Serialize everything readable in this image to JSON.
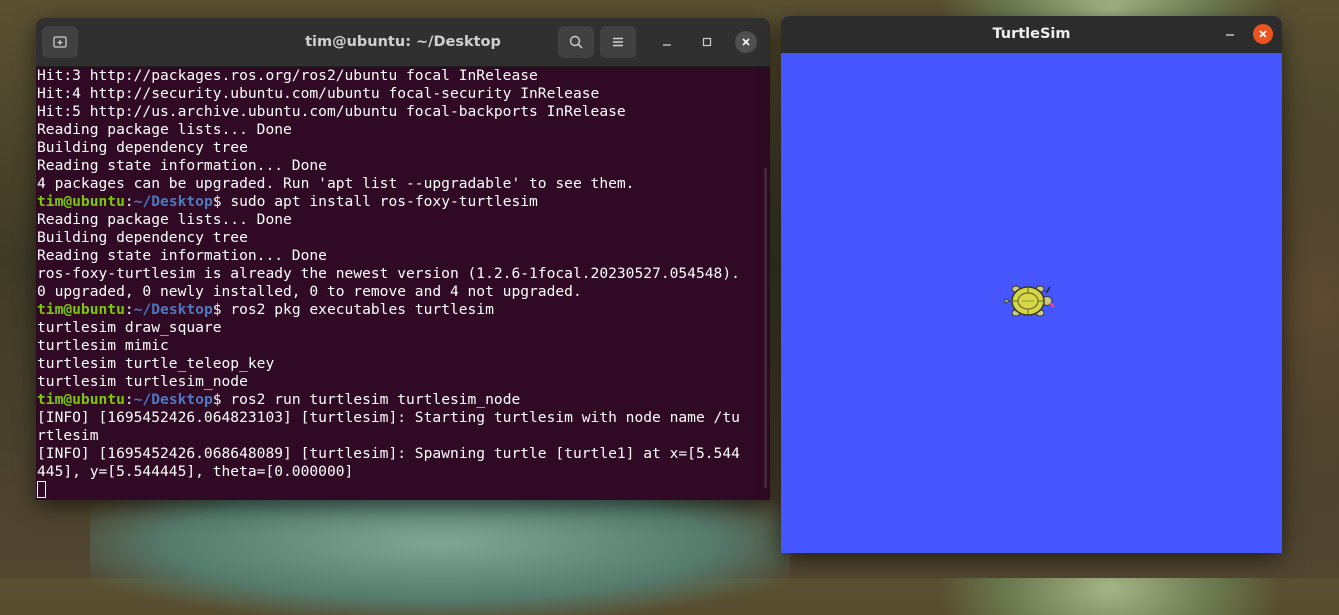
{
  "terminal": {
    "title": "tim@ubuntu: ~/Desktop",
    "lines": [
      {
        "type": "out",
        "text": "Hit:3 http://packages.ros.org/ros2/ubuntu focal InRelease"
      },
      {
        "type": "out",
        "text": "Hit:4 http://security.ubuntu.com/ubuntu focal-security InRelease"
      },
      {
        "type": "out",
        "text": "Hit:5 http://us.archive.ubuntu.com/ubuntu focal-backports InRelease"
      },
      {
        "type": "out",
        "text": "Reading package lists... Done"
      },
      {
        "type": "out",
        "text": "Building dependency tree"
      },
      {
        "type": "out",
        "text": "Reading state information... Done"
      },
      {
        "type": "out",
        "text": "4 packages can be upgraded. Run 'apt list --upgradable' to see them."
      },
      {
        "type": "prompt",
        "user": "tim@ubuntu",
        "path": "~/Desktop",
        "cmd": "$ sudo apt install ros-foxy-turtlesim"
      },
      {
        "type": "out",
        "text": "Reading package lists... Done"
      },
      {
        "type": "out",
        "text": "Building dependency tree"
      },
      {
        "type": "out",
        "text": "Reading state information... Done"
      },
      {
        "type": "out",
        "text": "ros-foxy-turtlesim is already the newest version (1.2.6-1focal.20230527.054548)."
      },
      {
        "type": "out",
        "text": "0 upgraded, 0 newly installed, 0 to remove and 4 not upgraded."
      },
      {
        "type": "prompt",
        "user": "tim@ubuntu",
        "path": "~/Desktop",
        "cmd": "$ ros2 pkg executables turtlesim"
      },
      {
        "type": "out",
        "text": "turtlesim draw_square"
      },
      {
        "type": "out",
        "text": "turtlesim mimic"
      },
      {
        "type": "out",
        "text": "turtlesim turtle_teleop_key"
      },
      {
        "type": "out",
        "text": "turtlesim turtlesim_node"
      },
      {
        "type": "prompt",
        "user": "tim@ubuntu",
        "path": "~/Desktop",
        "cmd": "$ ros2 run turtlesim turtlesim_node"
      },
      {
        "type": "out",
        "text": "[INFO] [1695452426.064823103] [turtlesim]: Starting turtlesim with node name /tu"
      },
      {
        "type": "out",
        "text": "rtlesim"
      },
      {
        "type": "out",
        "text": "[INFO] [1695452426.068648089] [turtlesim]: Spawning turtle [turtle1] at x=[5.544"
      },
      {
        "type": "out",
        "text": "445], y=[5.544445], theta=[0.000000]"
      }
    ],
    "colors": {
      "background": "#300a24",
      "prompt_user": "#7cc60b",
      "prompt_path": "#4d78c2"
    }
  },
  "turtlesim": {
    "title": "TurtleSim",
    "background_color": "#4556ff"
  }
}
